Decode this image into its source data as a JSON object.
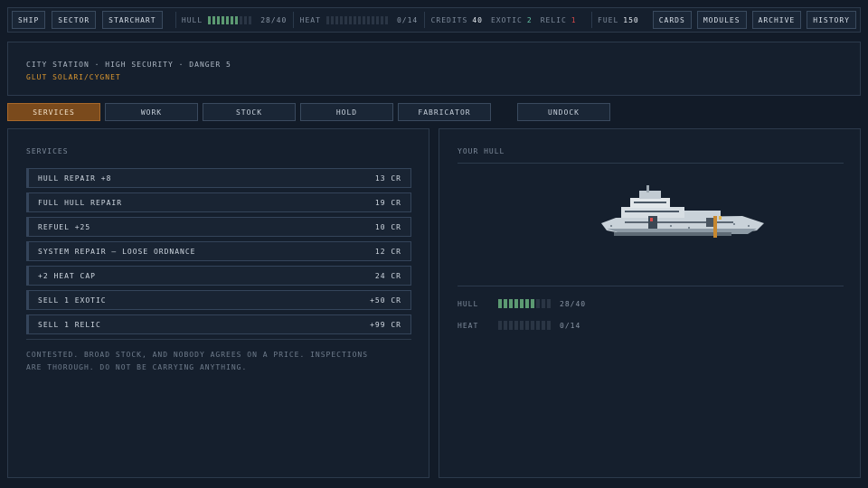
{
  "topbar": {
    "ship": "SHIP",
    "sector": "SECTOR",
    "starchart": "STARCHART",
    "hull_label": "HULL",
    "hull_value": "28/40",
    "hull_fraction": 0.7,
    "heat_label": "HEAT",
    "heat_value": "0/14",
    "heat_fraction": 0,
    "credits_label": "CREDITS",
    "credits_value": "40",
    "exotic_label": "EXOTIC",
    "exotic_value": "2",
    "relic_label": "RELIC",
    "relic_value": "1",
    "fuel_label": "FUEL",
    "fuel_value": "150",
    "cards": "CARDS",
    "modules": "MODULES",
    "archive": "ARCHIVE",
    "history": "HISTORY"
  },
  "location": {
    "line": "CITY STATION · HIGH SECURITY · DANGER 5",
    "faction": "GLUT SOLARI/CYGNET"
  },
  "tabs": {
    "services": "SERVICES",
    "work": "WORK",
    "stock": "STOCK",
    "hold": "HOLD",
    "fabricator": "FABRICATOR",
    "undock": "UNDOCK"
  },
  "services": {
    "title": "SERVICES",
    "items": [
      {
        "name": "HULL REPAIR +8",
        "price": "13 CR"
      },
      {
        "name": "FULL HULL REPAIR",
        "price": "19 CR"
      },
      {
        "name": "REFUEL +25",
        "price": "10 CR"
      },
      {
        "name": "SYSTEM REPAIR — LOOSE ORDNANCE",
        "price": "12 CR"
      },
      {
        "name": "+2 HEAT CAP",
        "price": "24 CR"
      },
      {
        "name": "SELL 1 EXOTIC",
        "price": "+50 CR"
      },
      {
        "name": "SELL 1 RELIC",
        "price": "+99 CR"
      }
    ],
    "flavor": "CONTESTED. BROAD STOCK, AND NOBODY AGREES ON A PRICE. INSPECTIONS ARE THOROUGH. DO NOT BE CARRYING ANYTHING."
  },
  "hull_panel": {
    "title": "YOUR HULL",
    "hull_label": "HULL",
    "hull_value": "28/40",
    "hull_fraction": 0.7,
    "heat_label": "HEAT",
    "heat_value": "0/14",
    "heat_fraction": 0
  },
  "colors": {
    "accent_active_tab": "#7a4a1c",
    "hull_bar": "#5c9a72",
    "faction": "#d9962f",
    "exotic": "#64c3a6",
    "relic": "#d94b4b"
  }
}
